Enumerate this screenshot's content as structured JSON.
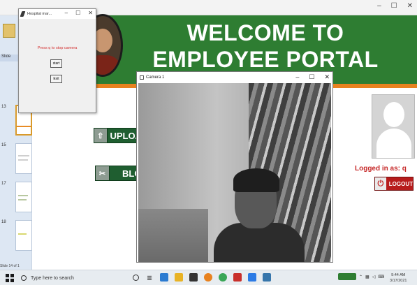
{
  "tk_window": {
    "title": "Hospital mar...",
    "hint": "Press q to stop camera",
    "start_label": "start",
    "exit_label": "Exit"
  },
  "camera_window": {
    "title": "Camera 1"
  },
  "portal": {
    "title": "WELCOME TO EMPLOYEE PORTAL",
    "upload_label": "UPLOA",
    "block_label": "BLC",
    "logged_in_text": "Logged in as: q",
    "logout_label": "LOGOUT"
  },
  "powerpoint": {
    "slide_tab": "Slide",
    "slide_status": "Slide 14 of 1",
    "slide_numbers": [
      "13",
      "15",
      "17",
      "18"
    ]
  },
  "taskbar": {
    "search_placeholder": "Type here to search",
    "time": "9:44 AM",
    "date": "3/17/2021"
  },
  "colors": {
    "banner": "#2e7d32",
    "accent_orange": "#e8821f",
    "logout": "#b71c1c",
    "hint_red": "#d32f2f"
  }
}
